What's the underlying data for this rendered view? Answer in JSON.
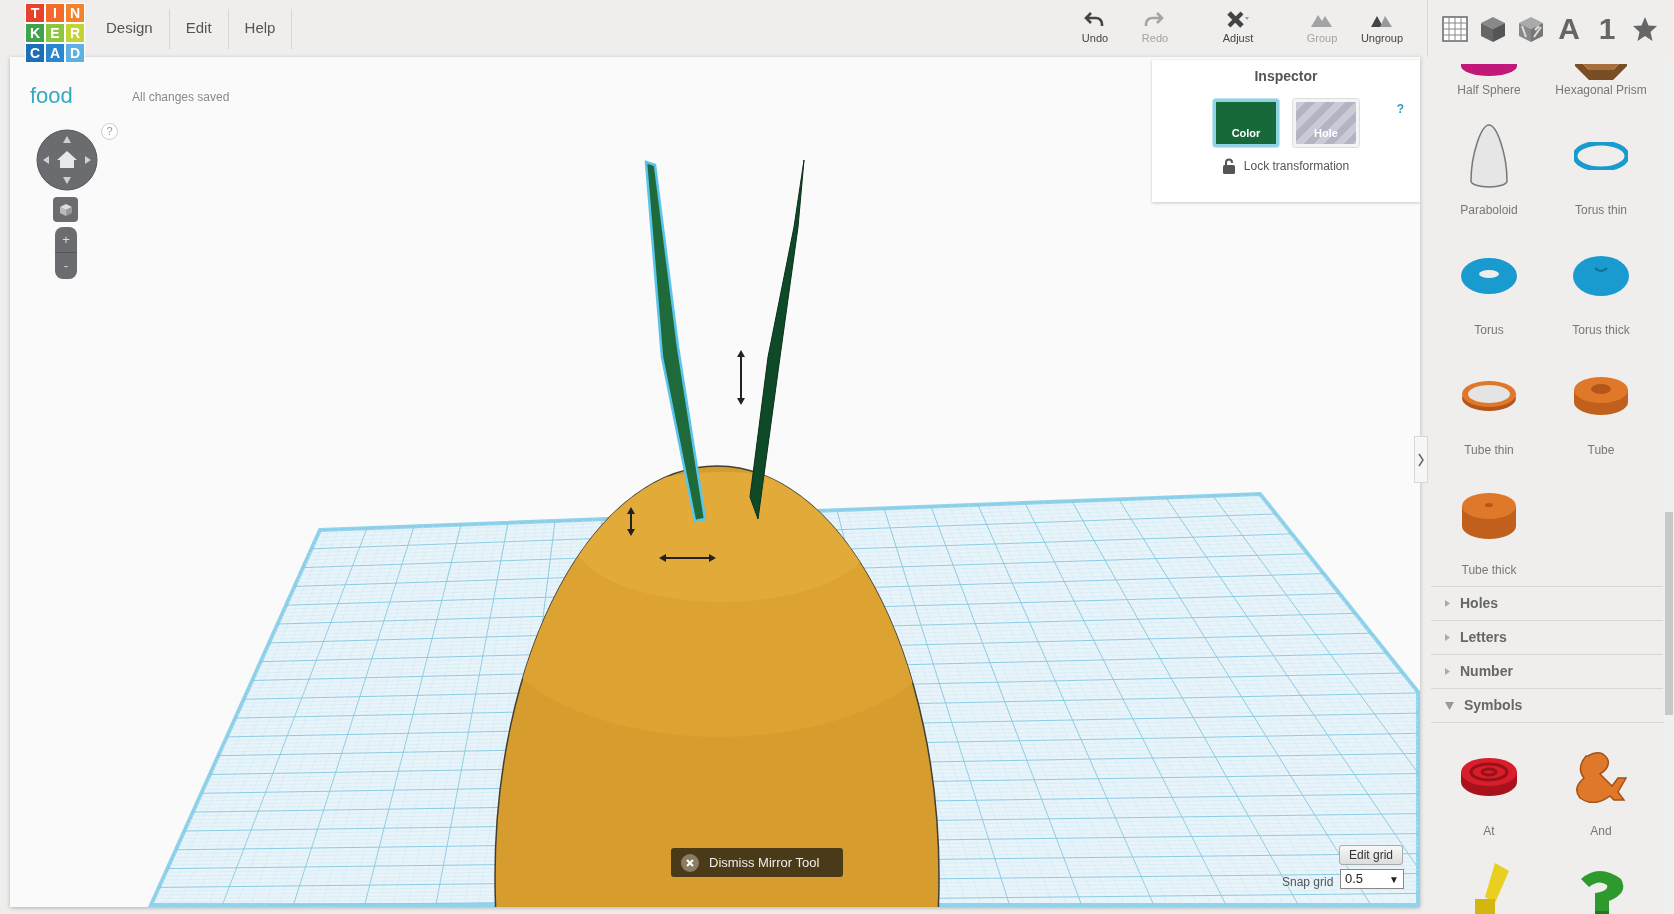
{
  "logo": [
    {
      "char": "T",
      "color": "#e8412c"
    },
    {
      "char": "I",
      "color": "#f26b2a"
    },
    {
      "char": "N",
      "color": "#f4812c"
    },
    {
      "char": "K",
      "color": "#3ea44b"
    },
    {
      "char": "E",
      "color": "#8cc63f"
    },
    {
      "char": "R",
      "color": "#c3d235"
    },
    {
      "char": "C",
      "color": "#1b6fb8"
    },
    {
      "char": "A",
      "color": "#2a87cf"
    },
    {
      "char": "D",
      "color": "#5cb0e2"
    }
  ],
  "menu": [
    {
      "label": "Design"
    },
    {
      "label": "Edit"
    },
    {
      "label": "Help"
    }
  ],
  "toolbar": [
    {
      "kind": "undo",
      "label": "Undo",
      "disabled": false
    },
    {
      "kind": "redo",
      "label": "Redo",
      "disabled": true
    },
    {
      "kind": "adjust",
      "label": "Adjust",
      "disabled": false
    },
    {
      "kind": "group",
      "label": "Group",
      "disabled": true
    },
    {
      "kind": "ungroup",
      "label": "Ungroup",
      "disabled": false
    }
  ],
  "library_tabs": [
    {
      "kind": "grid"
    },
    {
      "kind": "box"
    },
    {
      "kind": "hole-box"
    },
    {
      "kind": "text",
      "label": "A"
    },
    {
      "kind": "text",
      "label": "1"
    },
    {
      "kind": "star"
    }
  ],
  "design": {
    "title": "food",
    "save_status": "All changes saved"
  },
  "view_controls": {
    "help": "?",
    "zoom_in": "+",
    "zoom_out": "-"
  },
  "inspector": {
    "title": "Inspector",
    "help": "?",
    "swatches": [
      {
        "kind": "color",
        "label": "Color",
        "selected": true
      },
      {
        "kind": "hole",
        "label": "Hole",
        "selected": false
      }
    ],
    "lock": {
      "label": "Lock transformation",
      "locked": false
    }
  },
  "toast": {
    "label": "Dismiss Mirror Tool"
  },
  "grid_controls": {
    "edit_button": "Edit grid",
    "snap_label": "Snap grid",
    "snap_value": "0.5",
    "dropdown_arrow": "▼"
  },
  "shapes": [
    {
      "kind": "half-sphere",
      "label": "Half Sphere"
    },
    {
      "kind": "hex-prism",
      "label": "Hexagonal Prism"
    },
    {
      "kind": "paraboloid",
      "label": "Paraboloid"
    },
    {
      "kind": "torus-thin",
      "label": "Torus thin"
    },
    {
      "kind": "torus",
      "label": "Torus"
    },
    {
      "kind": "torus-thick",
      "label": "Torus thick"
    },
    {
      "kind": "tube-thin",
      "label": "Tube thin"
    },
    {
      "kind": "tube",
      "label": "Tube"
    },
    {
      "kind": "tube-thick",
      "label": "Tube thick"
    }
  ],
  "categories": [
    {
      "label": "Holes",
      "expanded": false
    },
    {
      "label": "Letters",
      "expanded": false
    },
    {
      "label": "Number",
      "expanded": false
    },
    {
      "label": "Symbols",
      "expanded": true,
      "shapes": [
        {
          "kind": "at",
          "label": "At"
        },
        {
          "kind": "and",
          "label": "And"
        },
        {
          "kind": "block-symbol"
        },
        {
          "kind": "hook-symbol"
        }
      ]
    }
  ]
}
